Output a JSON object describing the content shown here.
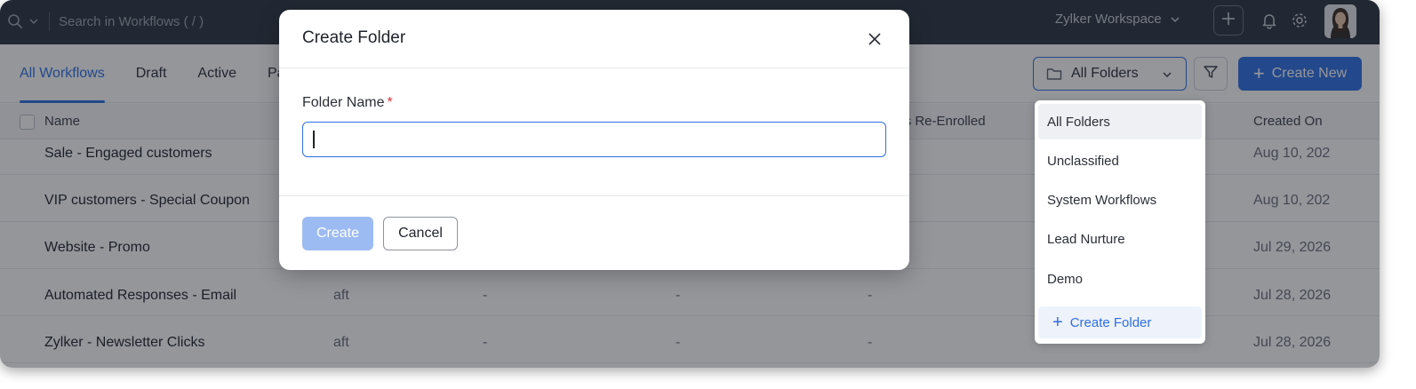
{
  "topbar": {
    "search_placeholder": "Search in Workflows ( / )",
    "workspace": "Zylker Workspace"
  },
  "tabs": [
    {
      "label": "All Workflows",
      "active": true
    },
    {
      "label": "Draft",
      "active": false
    },
    {
      "label": "Active",
      "active": false
    },
    {
      "label": "Pa",
      "active": false
    }
  ],
  "toolbar": {
    "folder_select": "All Folders",
    "create_new": "Create New"
  },
  "table": {
    "headers": {
      "name": "Name",
      "reenrolled": "cts Re-Enrolled",
      "created_on": "Created On"
    },
    "rows": [
      {
        "name": "Sale - Engaged customers",
        "status": "",
        "c1": "",
        "c2": "",
        "c3": "",
        "created": "Aug 10, 202"
      },
      {
        "name": "VIP customers - Special Coupon",
        "status": "",
        "c1": "",
        "c2": "",
        "c3": "",
        "created": "Aug 10, 202"
      },
      {
        "name": "Website - Promo",
        "status": "",
        "c1": "",
        "c2": "",
        "c3": "",
        "created": "Jul 29, 2026"
      },
      {
        "name": "Automated Responses - Email",
        "status": "aft",
        "c1": "-",
        "c2": "-",
        "c3": "-",
        "created": "Jul 28, 2026"
      },
      {
        "name": "Zylker - Newsletter Clicks",
        "status": "aft",
        "c1": "-",
        "c2": "-",
        "c3": "-",
        "created": "Jul 28, 2026"
      }
    ]
  },
  "folder_dropdown": {
    "items": [
      "All Folders",
      "Unclassified",
      "System Workflows",
      "Lead Nurture",
      "Demo"
    ],
    "selected": "All Folders",
    "create_folder": "Create Folder"
  },
  "modal": {
    "title": "Create Folder",
    "field_label": "Folder Name",
    "required_mark": "*",
    "field_value": "",
    "create_button": "Create",
    "cancel_button": "Cancel"
  },
  "colors": {
    "accent": "#2f6fe4",
    "topbar": "#2e3441",
    "create_disabled": "#9dbbf3",
    "required": "#e0323d"
  },
  "icons": [
    "search-icon",
    "chevron-down-icon",
    "plus-icon",
    "bell-icon",
    "gear-icon",
    "folder-icon",
    "filter-icon",
    "close-icon"
  ]
}
